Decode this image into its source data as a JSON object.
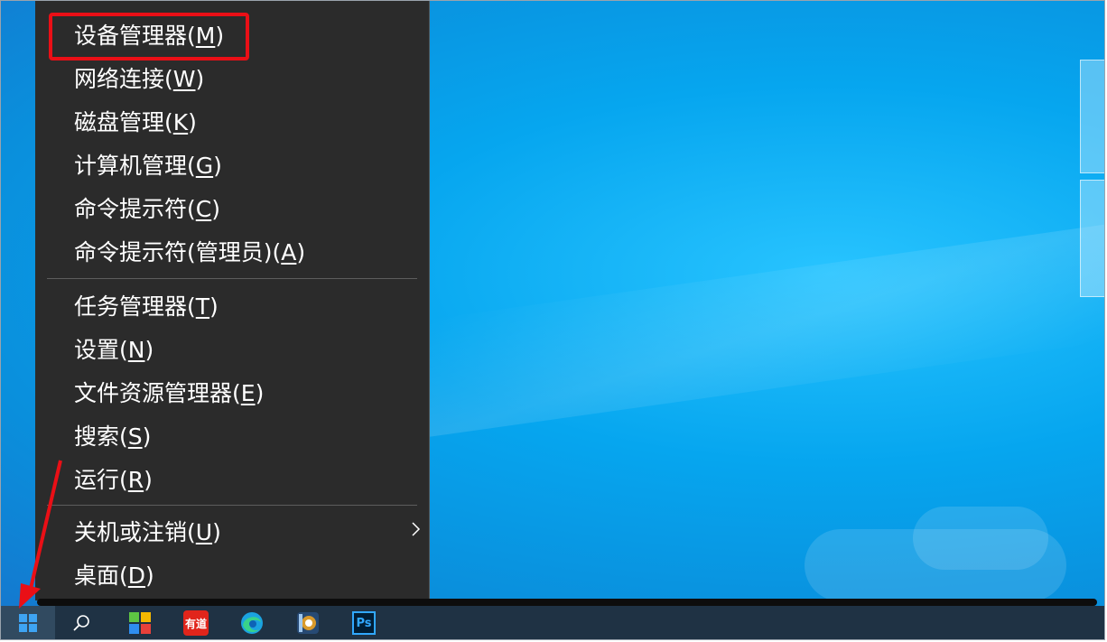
{
  "menu": {
    "items": [
      {
        "text": "设备管理器(",
        "key": "M",
        "close": ")"
      },
      {
        "text": "网络连接(",
        "key": "W",
        "close": ")"
      },
      {
        "text": "磁盘管理(",
        "key": "K",
        "close": ")"
      },
      {
        "text": "计算机管理(",
        "key": "G",
        "close": ")"
      },
      {
        "text": "命令提示符(",
        "key": "C",
        "close": ")"
      },
      {
        "text": "命令提示符(管理员)(",
        "key": "A",
        "close": ")"
      },
      {
        "text": "任务管理器(",
        "key": "T",
        "close": ")"
      },
      {
        "text": "设置(",
        "key": "N",
        "close": ")"
      },
      {
        "text": "文件资源管理器(",
        "key": "E",
        "close": ")"
      },
      {
        "text": "搜索(",
        "key": "S",
        "close": ")"
      },
      {
        "text": "运行(",
        "key": "R",
        "close": ")"
      },
      {
        "text": "关机或注销(",
        "key": "U",
        "close": ")"
      },
      {
        "text": "桌面(",
        "key": "D",
        "close": ")"
      }
    ],
    "submenu_icon": "chevron-right-icon"
  },
  "taskbar": {
    "start_icon": "windows-logo-icon",
    "apps": [
      {
        "name": "search-icon"
      },
      {
        "name": "store-tiles-icon"
      },
      {
        "name": "youdao-icon",
        "label": "有道"
      },
      {
        "name": "edge-icon"
      },
      {
        "name": "media-app-icon"
      },
      {
        "name": "photoshop-icon",
        "label": "Ps"
      }
    ]
  },
  "annotation": {
    "highlight_color": "#ea0f16",
    "arrow_color": "#ea0f16"
  }
}
